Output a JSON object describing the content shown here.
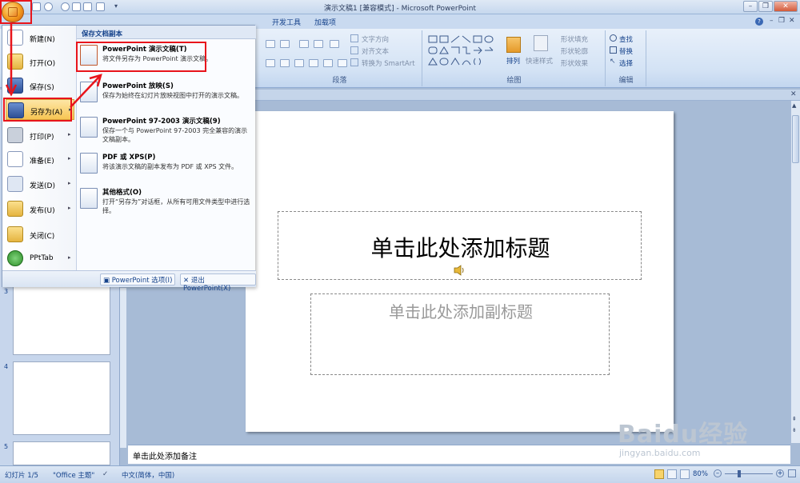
{
  "window": {
    "title": "演示文稿1 [兼容模式] - Microsoft PowerPoint"
  },
  "ribbon": {
    "tabs": [
      "开发工具",
      "加载项"
    ],
    "groups": {
      "paragraph": {
        "label": "段落",
        "text_direction": "文字方向",
        "align_text": "对齐文本",
        "convert_smartart": "转换为 SmartArt"
      },
      "drawing": {
        "label": "绘图",
        "arrange": "排列",
        "quick_styles": "快速样式",
        "shape_fill": "形状填充",
        "shape_outline": "形状轮廓",
        "shape_effects": "形状效果"
      },
      "editing": {
        "label": "编辑",
        "find": "查找",
        "replace": "替换",
        "select": "选择"
      }
    }
  },
  "office_menu": {
    "items": [
      {
        "label": "新建(N)",
        "arrow": false
      },
      {
        "label": "打开(O)",
        "arrow": false
      },
      {
        "label": "保存(S)",
        "arrow": false
      },
      {
        "label": "另存为(A)",
        "arrow": true
      },
      {
        "label": "打印(P)",
        "arrow": true
      },
      {
        "label": "准备(E)",
        "arrow": true
      },
      {
        "label": "发送(D)",
        "arrow": true
      },
      {
        "label": "发布(U)",
        "arrow": true
      },
      {
        "label": "关闭(C)",
        "arrow": false
      },
      {
        "label": "PPtTab",
        "arrow": true
      }
    ],
    "submenu": {
      "header": "保存文档副本",
      "items": [
        {
          "title": "PowerPoint 演示文稿(T)",
          "desc": "将文件另存为 PowerPoint 演示文稿。"
        },
        {
          "title": "PowerPoint 放映(S)",
          "desc": "保存为始终在幻灯片放映视图中打开的演示文稿。"
        },
        {
          "title": "PowerPoint 97-2003 演示文稿(9)",
          "desc": "保存一个与 PowerPoint 97-2003 完全兼容的演示文稿副本。"
        },
        {
          "title": "PDF 或 XPS(P)",
          "desc": "将该演示文稿的副本发布为 PDF 或 XPS 文件。"
        },
        {
          "title": "其他格式(O)",
          "desc": "打开“另存为”对话框，从所有可用文件类型中进行选择。"
        }
      ]
    },
    "footer": {
      "options": "PowerPoint 选项(I)",
      "exit": "退出 PowerPoint(X)"
    }
  },
  "thumbnails": {
    "numbers": [
      "3",
      "4",
      "5"
    ]
  },
  "slide": {
    "title_placeholder": "单击此处添加标题",
    "subtitle_placeholder": "单击此处添加副标题"
  },
  "notes": {
    "placeholder": "单击此处添加备注"
  },
  "status": {
    "slide_count": "幻灯片 1/5",
    "theme": "\"Office 主题\"",
    "language": "中文(简体，中国)",
    "zoom": "80%"
  },
  "watermark": {
    "brand": "Baidu经验",
    "url": "jingyan.baidu.com"
  }
}
